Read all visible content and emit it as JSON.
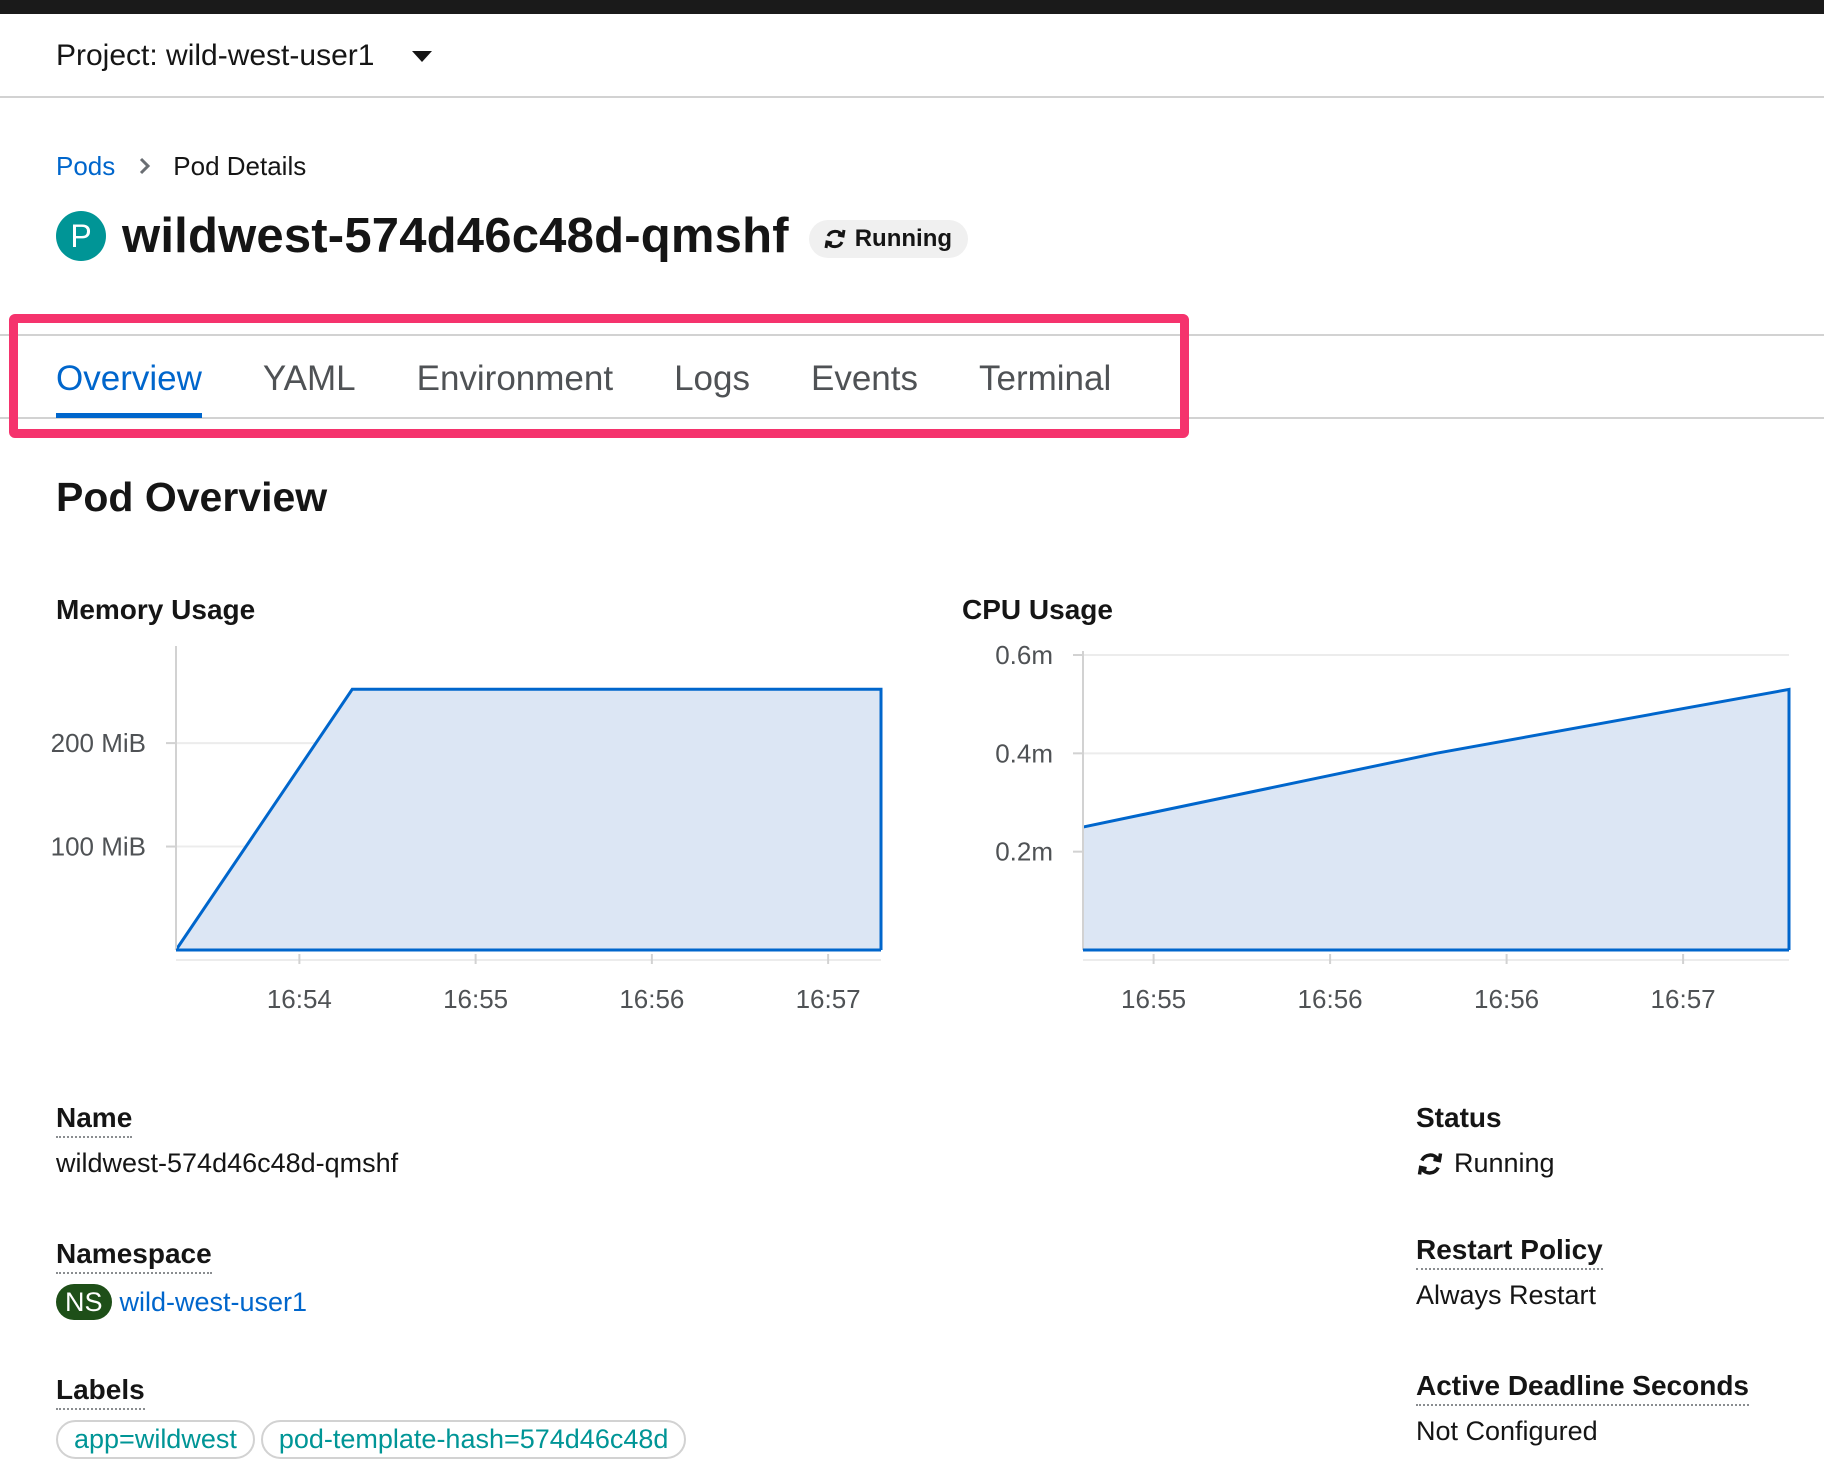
{
  "project": {
    "label": "Project: wild-west-user1"
  },
  "breadcrumb": {
    "parent": "Pods",
    "current": "Pod Details"
  },
  "pod": {
    "badge": "P",
    "name": "wildwest-574d46c48d-qmshf",
    "status": "Running"
  },
  "tabs": [
    {
      "label": "Overview",
      "active": true
    },
    {
      "label": "YAML"
    },
    {
      "label": "Environment"
    },
    {
      "label": "Logs"
    },
    {
      "label": "Events"
    },
    {
      "label": "Terminal"
    }
  ],
  "section": {
    "title": "Pod Overview"
  },
  "chart_data": [
    {
      "type": "area",
      "title": "Memory Usage",
      "xlabel": "",
      "ylabel": "",
      "x_ticks": [
        "16:54",
        "16:55",
        "16:56",
        "16:57"
      ],
      "y_ticks": [
        {
          "value": 100,
          "label": "100 MiB"
        },
        {
          "value": 200,
          "label": "200 MiB"
        }
      ],
      "ylim": [
        0,
        290
      ],
      "grid": true,
      "color": "#0066cc",
      "fill": "#dce6f4",
      "x_domain": [
        0,
        4
      ],
      "points": [
        {
          "x": 0.0,
          "y": 0
        },
        {
          "x": 1.0,
          "y": 252
        },
        {
          "x": 4.0,
          "y": 252
        }
      ],
      "x_tick_positions": [
        0.7,
        1.7,
        2.7,
        3.7
      ]
    },
    {
      "type": "area",
      "title": "CPU Usage",
      "xlabel": "",
      "ylabel": "",
      "x_ticks": [
        "16:55",
        "16:56",
        "16:56",
        "16:57"
      ],
      "y_ticks": [
        {
          "value": 0.2,
          "label": "0.2m"
        },
        {
          "value": 0.4,
          "label": "0.4m"
        },
        {
          "value": 0.6,
          "label": "0.6m"
        }
      ],
      "ylim": [
        0,
        0.6
      ],
      "grid": true,
      "color": "#0066cc",
      "fill": "#dce6f4",
      "x_domain": [
        0,
        4
      ],
      "points": [
        {
          "x": 0.0,
          "y": 0.25
        },
        {
          "x": 2.0,
          "y": 0.4
        },
        {
          "x": 4.0,
          "y": 0.53
        }
      ],
      "x_tick_positions": [
        0.4,
        1.4,
        2.4,
        3.4
      ]
    }
  ],
  "details": {
    "name": {
      "label": "Name",
      "value": "wildwest-574d46c48d-qmshf"
    },
    "namespace": {
      "label": "Namespace",
      "badge": "NS",
      "value": "wild-west-user1"
    },
    "labels": {
      "label": "Labels",
      "items": [
        "app=wildwest",
        "pod-template-hash=574d46c48d"
      ]
    },
    "status": {
      "label": "Status",
      "value": "Running"
    },
    "restart_policy": {
      "label": "Restart Policy",
      "value": "Always Restart"
    },
    "active_deadline": {
      "label": "Active Deadline Seconds",
      "value": "Not Configured"
    }
  }
}
